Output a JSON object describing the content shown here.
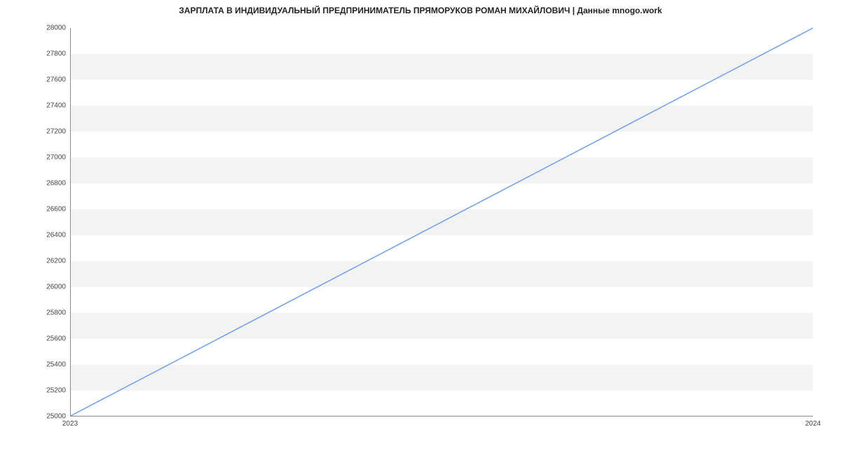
{
  "chart_data": {
    "type": "line",
    "title": "ЗАРПЛАТА В ИНДИВИДУАЛЬНЫЙ ПРЕДПРИНИМАТЕЛЬ ПРЯМОРУКОВ РОМАН МИХАЙЛОВИЧ | Данные mnogo.work",
    "xlabel": "",
    "ylabel": "",
    "x": [
      "2023",
      "2024"
    ],
    "series": [
      {
        "name": "salary",
        "values": [
          25000,
          28000
        ],
        "color": "#6f9fe8"
      }
    ],
    "xlim": [
      "2023",
      "2024"
    ],
    "ylim": [
      25000,
      28000
    ],
    "yticks": [
      25000,
      25200,
      25400,
      25600,
      25800,
      26000,
      26200,
      26400,
      26600,
      26800,
      27000,
      27200,
      27400,
      27600,
      27800,
      28000
    ],
    "xticks": [
      "2023",
      "2024"
    ],
    "grid": {
      "y_banding": true
    }
  }
}
